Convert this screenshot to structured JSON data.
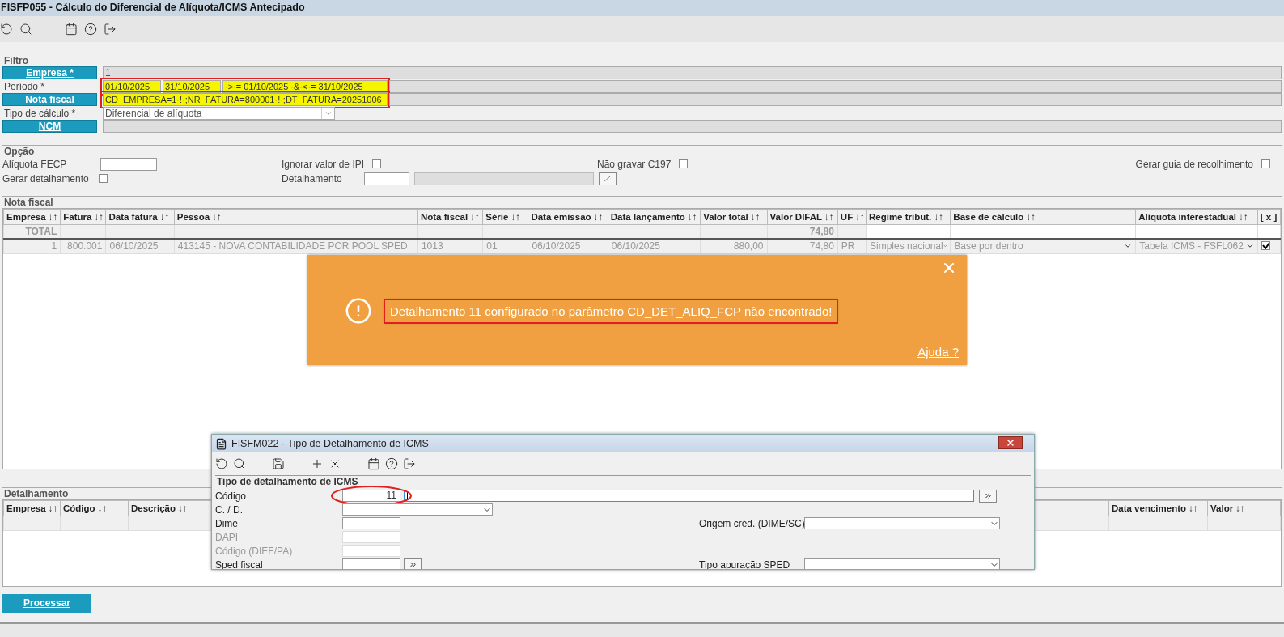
{
  "window": {
    "title": "FISFP055 - Cálculo do Diferencial de Alíquota/ICMS Antecipado"
  },
  "filter": {
    "title": "Filtro",
    "rows": [
      {
        "kind": "lookup",
        "label": "Empresa *",
        "value": "1",
        "highlighted": false,
        "marked": false
      },
      {
        "kind": "period",
        "label": "Período *",
        "from": "01/10/2025",
        "to": "31/10/2025",
        "value": "·>·= 01/10/2025 ·&·<·= 31/10/2025",
        "highlighted": true,
        "marked": true
      },
      {
        "kind": "lookup",
        "label": "Nota fiscal",
        "value": "CD_EMPRESA=1·!·;NR_FATURA=800001·!·;DT_FATURA=20251006",
        "highlighted": true,
        "marked": true
      },
      {
        "kind": "select",
        "label": "Tipo de cálculo *",
        "value": "Diferencial de alíquota",
        "highlighted": false,
        "marked": false
      },
      {
        "kind": "lookup",
        "label": "NCM",
        "highlighted": false,
        "marked": false
      }
    ]
  },
  "options": {
    "title": "Opção",
    "items": [
      {
        "kind": "input",
        "label": "Alíquota FECP"
      },
      {
        "kind": "checkbox",
        "label": "Ignorar valor de IPI",
        "checked": false
      },
      {
        "kind": "checkbox",
        "label": "Não gravar C197",
        "checked": false
      },
      {
        "kind": "checkbox",
        "label": "Gerar guia de recolhimento",
        "checked": false
      },
      {
        "kind": "checkbox",
        "label": "Gerar detalhamento",
        "checked": false
      },
      {
        "kind": "lookup",
        "label": "Detalhamento"
      }
    ]
  },
  "invoices": {
    "title": "Nota fiscal",
    "columns": [
      "Empresa ↓↑",
      "Fatura ↓↑",
      "Data fatura ↓↑",
      "Pessoa ↓↑",
      "Nota fiscal ↓↑",
      "Série ↓↑",
      "Data emissão ↓↑",
      "Data lançamento ↓↑",
      "Valor total ↓↑",
      "Valor DIFAL ↓↑",
      "UF ↓↑",
      "Regime tribut. ↓↑",
      "Base de cálculo ↓↑",
      "Alíquota interestadual ↓↑",
      "[ x ]"
    ],
    "total_label": "TOTAL",
    "total_difal": "74,80",
    "rows": [
      {
        "cells": [
          "1",
          "800.001",
          "06/10/2025",
          "413145 - NOVA CONTABILIDADE POR POOL SPED",
          "1013",
          "01",
          "06/10/2025",
          "06/10/2025",
          "880,00",
          "74,80",
          "PR",
          "Simples nacional",
          "Base por dentro",
          "Tabela ICMS - FSFL062"
        ],
        "checked": true
      }
    ]
  },
  "details": {
    "title": "Detalhamento",
    "columns": [
      "Empresa ↓↑",
      "Código ↓↑",
      "Descrição ↓↑",
      "Data vencimento ↓↑",
      "Valor ↓↑"
    ]
  },
  "process_button": "Processar",
  "alert": {
    "message": "Detalhamento 11 configurado no parâmetro CD_DET_ALIQ_FCP não encontrado!",
    "help_link": "Ajuda ?",
    "marked": true
  },
  "dialog": {
    "title": "FISFM022 - Tipo de Detalhamento de ICMS",
    "group": "Tipo de detalhamento de ICMS",
    "left": [
      {
        "kind": "code",
        "label": "Código",
        "value": "11",
        "disabled": false,
        "marked": true
      },
      {
        "kind": "select",
        "label": "C. / D.",
        "disabled": false,
        "marked": false
      },
      {
        "kind": "input",
        "label": "Dime",
        "disabled": false,
        "marked": false
      },
      {
        "kind": "input",
        "label": "DAPI",
        "disabled": true,
        "marked": false
      },
      {
        "kind": "input",
        "label": "Código (DIEF/PA)",
        "disabled": true,
        "marked": false
      },
      {
        "kind": "lookup",
        "label": "Sped fiscal",
        "disabled": false,
        "marked": false
      }
    ],
    "right": [
      {
        "label": "Origem créd. (DIME/SC)"
      },
      {
        "label": "Tipo apuração SPED"
      }
    ]
  }
}
